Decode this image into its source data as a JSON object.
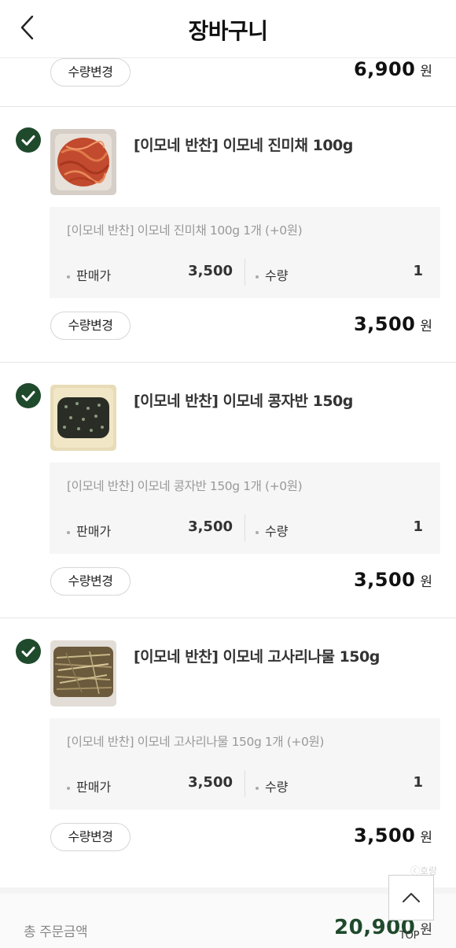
{
  "header": {
    "title": "장바구니",
    "back_icon": "chevron-left-icon"
  },
  "previous_item": {
    "qty_change_label": "수량변경",
    "line_total": "6,900",
    "currency": "원"
  },
  "items": [
    {
      "name": "[이모네 반찬] 이모네 진미채 100g",
      "option": "[이모네 반찬] 이모네 진미채 100g 1개 (+0원)",
      "price_label": "판매가",
      "price": "3,500",
      "qty_label": "수량",
      "qty": "1",
      "qty_change_label": "수량변경",
      "line_total": "3,500",
      "currency": "원",
      "checked": true,
      "thumb_icon": "dried-squid-dish-image"
    },
    {
      "name": "[이모네 반찬] 이모네 콩자반 150g",
      "option": "[이모네 반찬] 이모네 콩자반 150g 1개 (+0원)",
      "price_label": "판매가",
      "price": "3,500",
      "qty_label": "수량",
      "qty": "1",
      "qty_change_label": "수량변경",
      "line_total": "3,500",
      "currency": "원",
      "checked": true,
      "thumb_icon": "braised-beans-dish-image"
    },
    {
      "name": "[이모네 반찬] 이모네 고사리나물 150g",
      "option": "[이모네 반찬] 이모네 고사리나물 150g 1개 (+0원)",
      "price_label": "판매가",
      "price": "3,500",
      "qty_label": "수량",
      "qty": "1",
      "qty_change_label": "수량변경",
      "line_total": "3,500",
      "currency": "원",
      "checked": true,
      "thumb_icon": "bracken-namul-dish-image"
    }
  ],
  "summary": {
    "label": "총 주문금액",
    "total": "20,900",
    "currency": "원"
  },
  "top_button": {
    "label": "TOP",
    "icon": "chevron-up-icon"
  },
  "watermark": "ⓒ호랑",
  "colors": {
    "accent": "#1f4a2c",
    "check_bg": "#1f4a2c",
    "option_bg": "#f6f6f6"
  }
}
